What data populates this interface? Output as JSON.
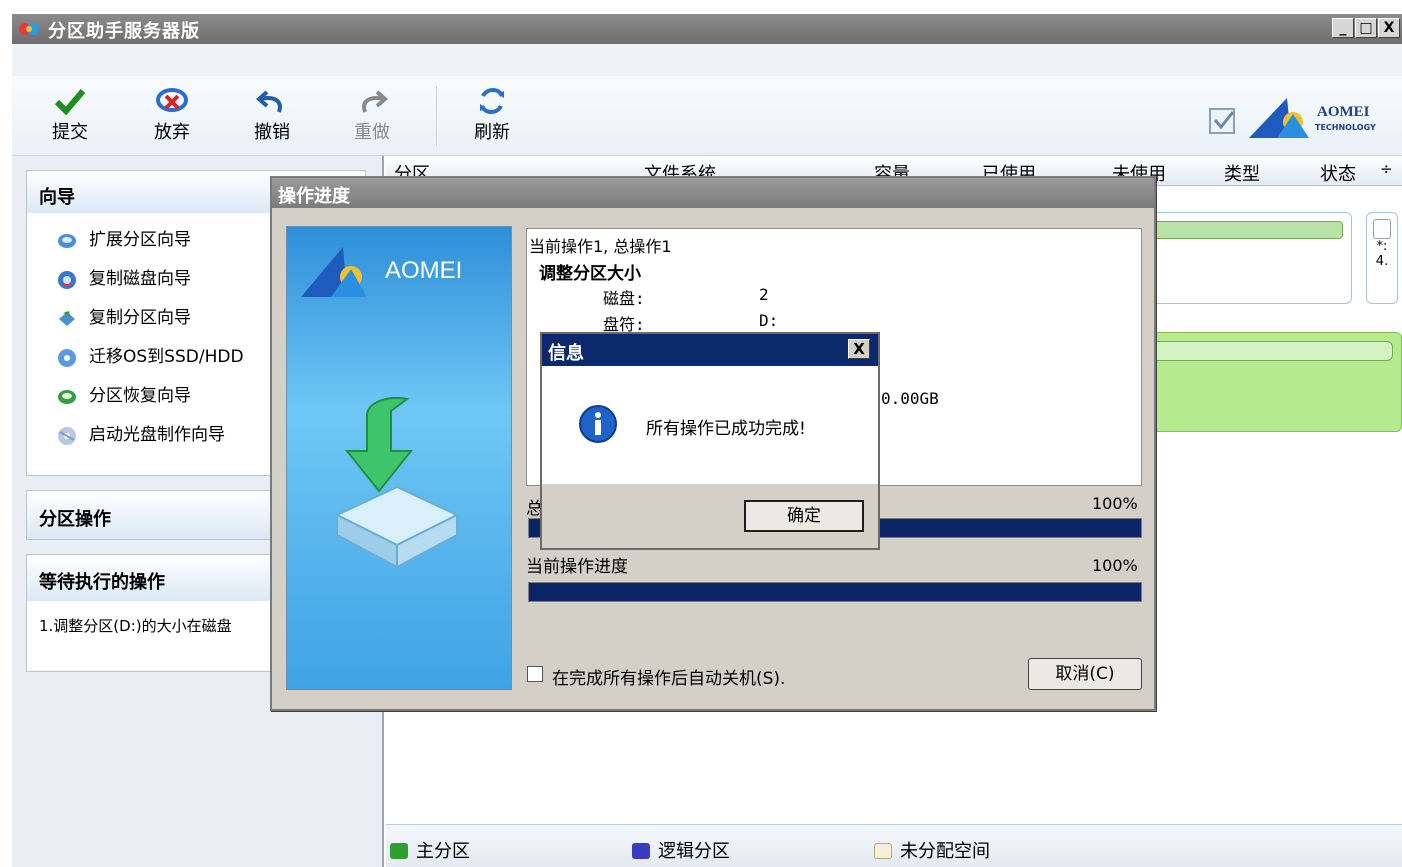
{
  "window": {
    "title": "分区助手服务器版",
    "controls": [
      "_",
      "□",
      "X"
    ]
  },
  "toolbar": {
    "commit": "提交",
    "discard": "放弃",
    "undo": "撤销",
    "redo": "重做",
    "refresh": "刷新",
    "brand_name": "AOMEI",
    "brand_sub": "TECHNOLOGY"
  },
  "wizard": {
    "title": "向导",
    "items": [
      {
        "label": "扩展分区向导",
        "icon": "extend-partition-icon"
      },
      {
        "label": "复制磁盘向导",
        "icon": "copy-disk-icon"
      },
      {
        "label": "复制分区向导",
        "icon": "copy-partition-icon"
      },
      {
        "label": "迁移OS到SSD/HDD",
        "icon": "migrate-os-icon"
      },
      {
        "label": "分区恢复向导",
        "icon": "partition-recovery-icon"
      },
      {
        "label": "启动光盘制作向导",
        "icon": "bootable-disc-icon"
      }
    ]
  },
  "partition_ops": {
    "title": "分区操作"
  },
  "pending_ops": {
    "title": "等待执行的操作",
    "items": [
      "1.调整分区(D:)的大小在磁盘"
    ]
  },
  "columns": [
    "分区",
    "文件系统",
    "容量",
    "已使用",
    "未使用",
    "类型",
    "状态"
  ],
  "disk_side": {
    "line1": "*:",
    "line2": "4."
  },
  "legend": {
    "primary": "主分区",
    "logical": "逻辑分区",
    "unallocated": "未分配空间"
  },
  "progress_dialog": {
    "title": "操作进度",
    "banner_brand": "AOMEI",
    "log": {
      "current": "当前操作1, 总操作1",
      "operation": "调整分区大小",
      "disk_label": "磁盘:",
      "disk_value": "2",
      "drive_label": "盘符:",
      "drive_value": "D:",
      "size_value": "0.00GB"
    },
    "total_label": "总",
    "total_percent": "100%",
    "current_label": "当前操作进度",
    "current_percent": "100%",
    "auto_shutdown": "在完成所有操作后自动关机(S).",
    "cancel": "取消(C)"
  },
  "info_dialog": {
    "title": "信息",
    "message": "所有操作已成功完成!",
    "ok": "确定",
    "close": "X"
  },
  "colors": {
    "primary": "#2f9e2f",
    "logical": "#3a3ac0",
    "progress": "#0b2466",
    "dialog_title": "#0a2a6b"
  }
}
